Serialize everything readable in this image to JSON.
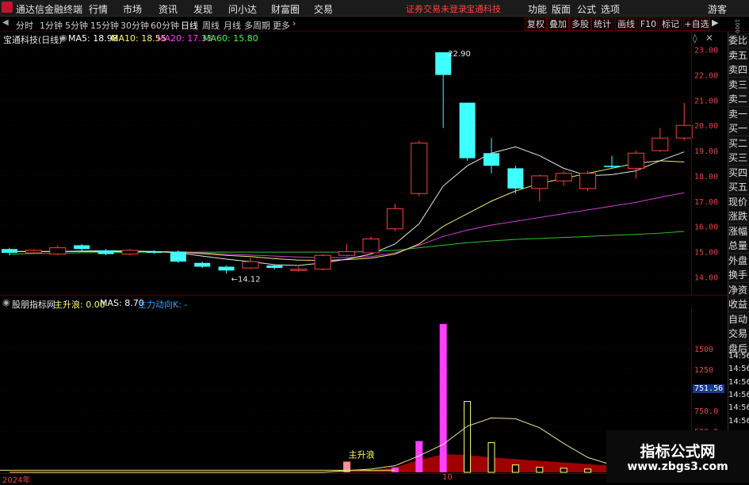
{
  "menubar": {
    "app_title": "通达信金融终端",
    "items": [
      "行情",
      "市场",
      "资讯",
      "发现",
      "问小达",
      "财富圈",
      "交易"
    ],
    "warning": "证券交易未登录",
    "stock_name": "宝通科技",
    "right_items": [
      "功能",
      "版面",
      "公式",
      "选项"
    ],
    "user": "游客"
  },
  "periods": {
    "items": [
      "分时",
      "1分钟",
      "5分钟",
      "15分钟",
      "30分钟",
      "60分钟",
      "日线",
      "周线",
      "月线",
      "多周期",
      "更多"
    ],
    "active": "日线"
  },
  "toolbar_buttons": [
    "复权",
    "叠加",
    "多股",
    "统计",
    "画线",
    "F10",
    "标记",
    "+自选"
  ],
  "main_chart": {
    "header_name": "宝通科技(日线)",
    "ma": [
      {
        "label": "MA5: 18.98",
        "color": "#ffffff"
      },
      {
        "label": "MA10: 18.55",
        "color": "#ffff60"
      },
      {
        "label": "MA20: 17.33",
        "color": "#ff40ff"
      },
      {
        "label": "MA60: 15.80",
        "color": "#40ff40"
      }
    ],
    "high_label": "22.90",
    "low_label": "14.12",
    "y_ticks": [
      "23.00",
      "22.00",
      "21.00",
      "20.00",
      "19.00",
      "18.00",
      "17.00",
      "16.00",
      "15.00",
      "14.00"
    ]
  },
  "indicator": {
    "name": "股朋指标网",
    "fields": [
      {
        "label": "主升浪: 0.00",
        "color": "#ffff60"
      },
      {
        "label": "MAS: 8.70",
        "color": "#ffffff"
      },
      {
        "label": "主力动向K: -",
        "color": "#40a0ff"
      }
    ],
    "annotation": "主升浪",
    "y_ticks": [
      "1500",
      "1250",
      "1000",
      "750.0",
      "500.0"
    ],
    "current_value": "751.56"
  },
  "xaxis": {
    "labels": [
      "2024年",
      "10"
    ]
  },
  "right_panel": {
    "items": [
      "委比",
      "卖五",
      "卖四",
      "卖三",
      "卖二",
      "卖一",
      "买一",
      "买二",
      "买三",
      "买四",
      "买五",
      "现价",
      "涨跌",
      "涨幅",
      "总量",
      "外盘",
      "换手",
      "净资",
      "收益",
      "自动",
      "交易",
      "盘后"
    ],
    "times": [
      "14:56",
      "14:56",
      "14:56",
      "14:56",
      "14:56",
      "14:56",
      "14:56",
      "14:56",
      "14:56"
    ],
    "scroll_label": "1000"
  },
  "watermark": {
    "line1": "指标公式网",
    "line2": "www.zbgs3.com"
  },
  "chart_data": [
    {
      "type": "candlestick",
      "ylim": [
        13.6,
        23.4
      ],
      "candles": [
        {
          "o": 15.1,
          "c": 14.95,
          "h": 15.15,
          "l": 14.85
        },
        {
          "o": 14.95,
          "c": 15.05,
          "h": 15.1,
          "l": 14.9
        },
        {
          "o": 14.9,
          "c": 15.15,
          "h": 15.25,
          "l": 14.85
        },
        {
          "o": 15.25,
          "c": 15.1,
          "h": 15.3,
          "l": 15.0
        },
        {
          "o": 15.05,
          "c": 14.9,
          "h": 15.1,
          "l": 14.85
        },
        {
          "o": 14.9,
          "c": 15.05,
          "h": 15.1,
          "l": 14.85
        },
        {
          "o": 15.0,
          "c": 14.95,
          "h": 15.05,
          "l": 14.9
        },
        {
          "o": 15.0,
          "c": 14.6,
          "h": 15.05,
          "l": 14.55
        },
        {
          "o": 14.55,
          "c": 14.4,
          "h": 14.6,
          "l": 14.35
        },
        {
          "o": 14.4,
          "c": 14.25,
          "h": 14.45,
          "l": 14.12
        },
        {
          "o": 14.35,
          "c": 14.6,
          "h": 14.75,
          "l": 14.3
        },
        {
          "o": 14.45,
          "c": 14.35,
          "h": 14.5,
          "l": 14.3
        },
        {
          "o": 14.25,
          "c": 14.3,
          "h": 14.4,
          "l": 14.2
        },
        {
          "o": 14.3,
          "c": 14.85,
          "h": 14.9,
          "l": 14.25
        },
        {
          "o": 14.85,
          "c": 15.0,
          "h": 15.3,
          "l": 14.8
        },
        {
          "o": 14.95,
          "c": 15.5,
          "h": 15.6,
          "l": 14.9
        },
        {
          "o": 15.9,
          "c": 16.7,
          "h": 16.9,
          "l": 15.8
        },
        {
          "o": 17.3,
          "c": 19.3,
          "h": 19.4,
          "l": 17.2
        },
        {
          "o": 22.9,
          "c": 22.0,
          "h": 22.9,
          "l": 19.9
        },
        {
          "o": 20.9,
          "c": 18.7,
          "h": 20.9,
          "l": 18.6
        },
        {
          "o": 18.9,
          "c": 18.4,
          "h": 19.5,
          "l": 18.1
        },
        {
          "o": 18.3,
          "c": 17.5,
          "h": 18.4,
          "l": 17.3
        },
        {
          "o": 17.5,
          "c": 18.0,
          "h": 18.05,
          "l": 17.0
        },
        {
          "o": 17.8,
          "c": 18.1,
          "h": 18.2,
          "l": 17.6
        },
        {
          "o": 17.5,
          "c": 18.1,
          "h": 18.2,
          "l": 17.4
        },
        {
          "o": 18.4,
          "c": 18.35,
          "h": 18.8,
          "l": 18.3
        },
        {
          "o": 18.3,
          "c": 18.9,
          "h": 19.0,
          "l": 17.9
        },
        {
          "o": 19.0,
          "c": 19.5,
          "h": 19.9,
          "l": 18.95
        },
        {
          "o": 19.5,
          "c": 20.0,
          "h": 20.9,
          "l": 19.4
        }
      ],
      "ma5": [
        15.0,
        15.0,
        15.0,
        15.02,
        15.03,
        15.02,
        15.0,
        14.95,
        14.82,
        14.7,
        14.6,
        14.48,
        14.45,
        14.55,
        14.7,
        14.9,
        15.3,
        16.1,
        17.6,
        18.4,
        18.9,
        19.15,
        18.8,
        18.3,
        18.0,
        18.05,
        18.2,
        18.6,
        18.95
      ],
      "ma10": [
        15.0,
        15.0,
        15.0,
        15.0,
        15.0,
        15.0,
        15.0,
        14.98,
        14.92,
        14.85,
        14.8,
        14.72,
        14.66,
        14.65,
        14.68,
        14.74,
        14.9,
        15.3,
        16.0,
        16.5,
        17.0,
        17.4,
        17.7,
        17.9,
        18.1,
        18.3,
        18.5,
        18.6,
        18.55
      ],
      "ma20": [
        15.0,
        15.0,
        15.0,
        15.0,
        15.0,
        15.0,
        15.0,
        14.98,
        14.95,
        14.9,
        14.86,
        14.82,
        14.78,
        14.76,
        14.76,
        14.8,
        14.95,
        15.25,
        15.6,
        15.85,
        16.05,
        16.2,
        16.35,
        16.5,
        16.65,
        16.8,
        16.95,
        17.15,
        17.33
      ],
      "ma60": [
        14.9,
        14.92,
        14.93,
        14.95,
        14.96,
        14.97,
        14.98,
        14.98,
        14.98,
        14.98,
        14.98,
        14.98,
        14.98,
        14.98,
        14.98,
        15.0,
        15.05,
        15.15,
        15.25,
        15.35,
        15.42,
        15.48,
        15.52,
        15.56,
        15.6,
        15.64,
        15.68,
        15.73,
        15.8
      ]
    },
    {
      "type": "bar",
      "ylim": [
        0,
        2000
      ],
      "bars": [
        {
          "i": 14,
          "v": 130,
          "color": "#ff9090",
          "style": "fill"
        },
        {
          "i": 16,
          "v": 60,
          "color": "#ff40ff",
          "style": "fill"
        },
        {
          "i": 17,
          "v": 380,
          "color": "#ff40ff",
          "style": "fill"
        },
        {
          "i": 18,
          "v": 1800,
          "color": "#ff40ff",
          "style": "fill"
        },
        {
          "i": 19,
          "v": 860,
          "color": "#ffff80",
          "style": "hollow"
        },
        {
          "i": 20,
          "v": 360,
          "color": "#ffff80",
          "style": "hollow"
        },
        {
          "i": 21,
          "v": 90,
          "color": "#ffff80",
          "style": "hollow"
        },
        {
          "i": 22,
          "v": 60,
          "color": "#ffff80",
          "style": "hollow"
        },
        {
          "i": 23,
          "v": 50,
          "color": "#ffff80",
          "style": "hollow"
        },
        {
          "i": 24,
          "v": 40,
          "color": "#ffff80",
          "style": "hollow"
        }
      ],
      "area": [
        10,
        10,
        10,
        10,
        10,
        10,
        10,
        10,
        10,
        10,
        10,
        10,
        10,
        10,
        15,
        25,
        60,
        150,
        220,
        210,
        180,
        160,
        140,
        120,
        100,
        80,
        60,
        40,
        30
      ],
      "mas": [
        0,
        0,
        0,
        0,
        0,
        0,
        0,
        0,
        0,
        0,
        0,
        0,
        0,
        0,
        20,
        40,
        80,
        200,
        340,
        560,
        660,
        650,
        540,
        350,
        180,
        90,
        50,
        30,
        20
      ]
    }
  ]
}
